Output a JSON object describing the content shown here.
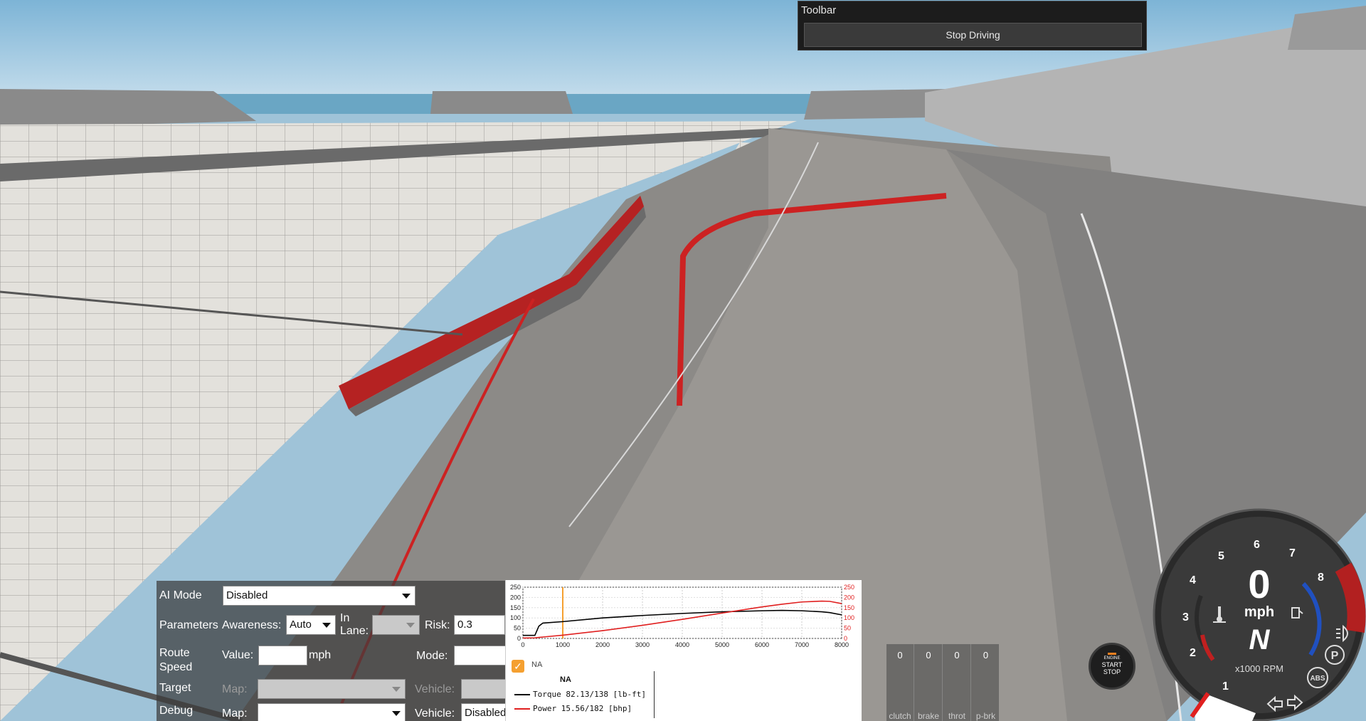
{
  "toolbar": {
    "title": "Toolbar",
    "stop_driving": "Stop Driving"
  },
  "ai": {
    "ai_mode_label": "AI Mode",
    "ai_mode_value": "Disabled",
    "parameters_label": "Parameters",
    "awareness_label": "Awareness:",
    "awareness_value": "Auto",
    "in_lane_label": "In Lane:",
    "in_lane_value": "",
    "risk_label": "Risk:",
    "risk_value": "0.3",
    "route_speed_label": "Route Speed",
    "value_label": "Value:",
    "value_value": "",
    "mph_label": "mph",
    "mode_label": "Mode:",
    "mode_value": "",
    "target_label": "Target",
    "target_map_label": "Map:",
    "target_vehicle_label": "Vehicle:",
    "debug_label": "Debug",
    "debug_map_label": "Map:",
    "debug_vehicle_label": "Vehicle:",
    "debug_vehicle_value": "Disabled"
  },
  "engine": {
    "checkbox_label": "NA",
    "legend_title": "NA",
    "torque_legend": "Torque 82.13/138 [lb-ft]",
    "power_legend": "Power  15.56/182 [bhp]"
  },
  "chart_data": {
    "type": "line",
    "x": [
      0,
      300,
      400,
      500,
      1000,
      2000,
      3000,
      4000,
      5000,
      6000,
      6500,
      7000,
      7500,
      7700,
      8000
    ],
    "x_ticks": [
      "0",
      "1000",
      "2000",
      "3000",
      "4000",
      "5000",
      "6000",
      "7000",
      "8000"
    ],
    "y_ticks_left": [
      "250",
      "200",
      "150",
      "100",
      "50",
      "0"
    ],
    "y_ticks_right": [
      "250",
      "200",
      "150",
      "100",
      "50",
      "0"
    ],
    "xlim": [
      0,
      8000
    ],
    "ylim": [
      0,
      250
    ],
    "cursor_x": 1000,
    "series": [
      {
        "name": "Torque",
        "color": "#000000",
        "values": [
          15,
          15,
          60,
          75,
          82,
          100,
          112,
          122,
          130,
          135,
          137,
          135,
          130,
          126,
          115
        ]
      },
      {
        "name": "Power",
        "color": "#e02020",
        "values": [
          2,
          3,
          5,
          7,
          16,
          38,
          64,
          93,
          124,
          154,
          167,
          178,
          182,
          181,
          170
        ]
      }
    ]
  },
  "pedals": [
    {
      "value": "0",
      "name": "clutch"
    },
    {
      "value": "0",
      "name": "brake"
    },
    {
      "value": "0",
      "name": "throt"
    },
    {
      "value": "0",
      "name": "p-brk"
    }
  ],
  "start_button": {
    "line1": "ENGINE",
    "line2": "START",
    "line3": "STOP"
  },
  "gauge": {
    "speed": "0",
    "speed_unit": "mph",
    "gear": "N",
    "rpm_unit": "x1000 RPM",
    "rpm_ticks": [
      "1",
      "2",
      "3",
      "4",
      "5",
      "6",
      "7",
      "8"
    ],
    "abs_label": "ABS",
    "park_label": "P"
  }
}
